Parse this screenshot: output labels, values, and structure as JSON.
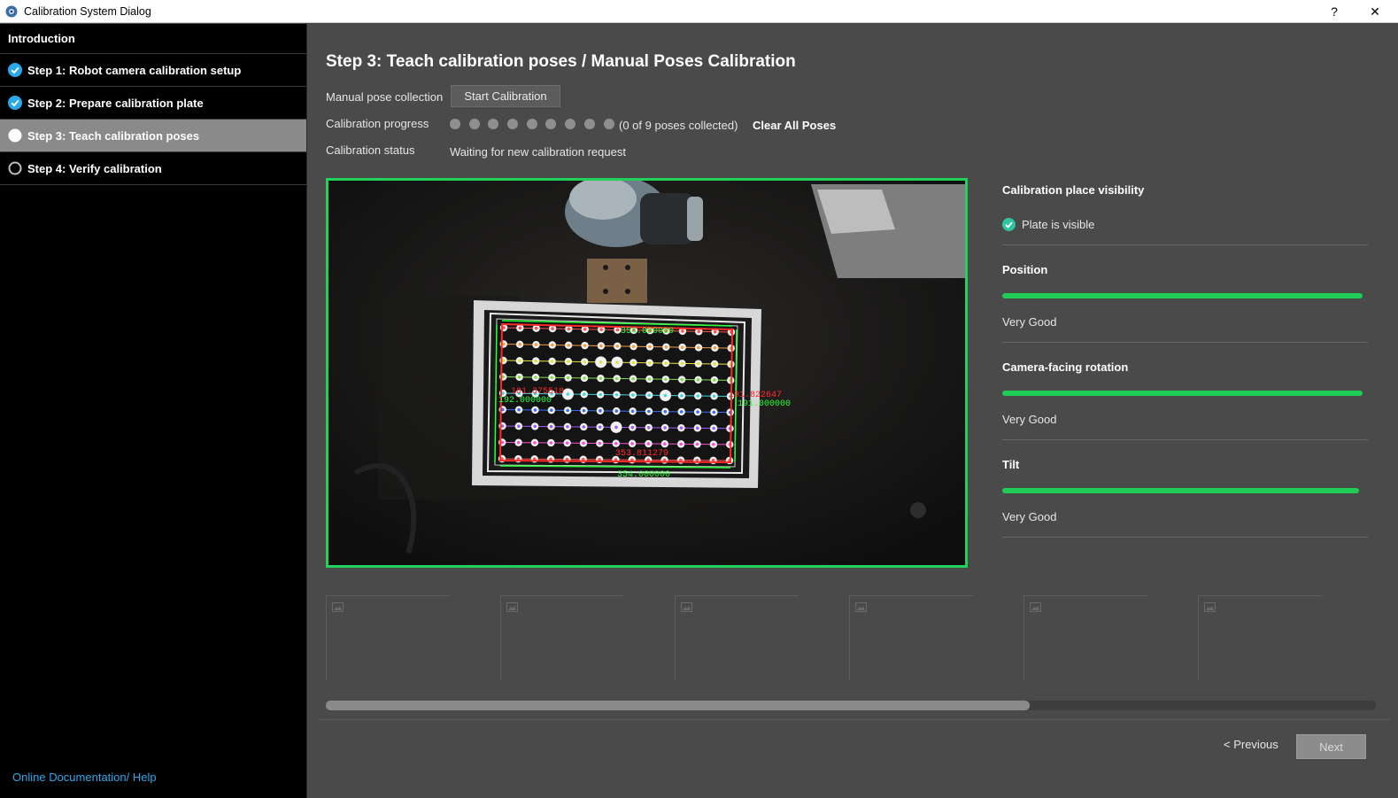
{
  "window": {
    "title": "Calibration System Dialog",
    "help": "?",
    "close": "✕"
  },
  "sidebar": {
    "items": [
      {
        "label": "Introduction",
        "state": "header"
      },
      {
        "label": "Step 1: Robot camera calibration setup",
        "state": "done"
      },
      {
        "label": "Step 2: Prepare calibration plate",
        "state": "done"
      },
      {
        "label": "Step 3: Teach calibration poses",
        "state": "active"
      },
      {
        "label": "Step 4: Verify calibration",
        "state": "todo"
      }
    ],
    "help_link": "Online Documentation/ Help"
  },
  "main": {
    "title": "Step 3: Teach calibration poses / Manual Poses Calibration",
    "manual_label": "Manual pose collection",
    "start_button": "Start Calibration",
    "progress_label": "Calibration progress",
    "poses_collected": 0,
    "poses_total": 9,
    "poses_text": "(0 of 9 poses collected)",
    "clear_button": "Clear All Poses",
    "status_label": "Calibration status",
    "status_value": "Waiting for new calibration request"
  },
  "camera": {
    "overlay_texts": [
      "354.000000",
      "181.375518",
      "192.000000",
      "191.822647",
      "191.000000",
      "353.811279",
      "354.000000"
    ],
    "border_color": "#22d15a"
  },
  "quality": {
    "visibility_title": "Calibration place visibility",
    "visibility_value": "Plate is visible",
    "metrics": [
      {
        "title": "Position",
        "value": "Very Good",
        "level": 0.985
      },
      {
        "title": "Camera-facing rotation",
        "value": "Very Good",
        "level": 0.985
      },
      {
        "title": "Tilt",
        "value": "Very Good",
        "level": 0.975
      }
    ],
    "bar_color": "#1fcc55"
  },
  "thumbnails": {
    "count": 6,
    "scroll_fraction": 0.67
  },
  "nav": {
    "previous": "< Previous",
    "next": "Next"
  }
}
